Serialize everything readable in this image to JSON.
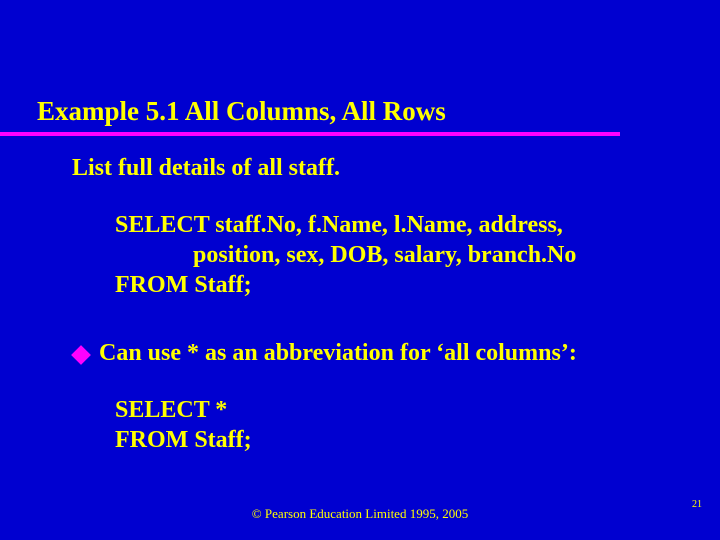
{
  "title": "Example 5.1  All Columns, All Rows",
  "subtitle": "List full details of all staff.",
  "query1": {
    "line1": "SELECT staff.No, f.Name, l.Name, address,",
    "line2": "position, sex, DOB, salary, branch.No",
    "line3": "FROM Staff;"
  },
  "bullet_text": "Can use * as an abbreviation for ‘all columns’:",
  "query2": {
    "line1": "SELECT *",
    "line2": "FROM Staff;"
  },
  "footer": "© Pearson Education Limited 1995, 2005",
  "page_number": "21"
}
